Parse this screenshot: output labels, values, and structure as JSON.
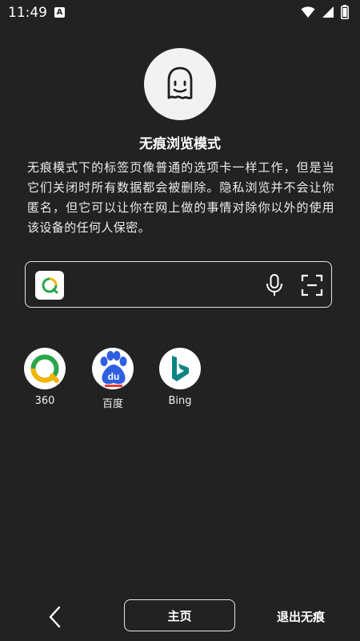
{
  "status_bar": {
    "time": "11:49",
    "notification_icon": "A",
    "icons": [
      "wifi-icon",
      "signal-icon",
      "battery-icon"
    ]
  },
  "incognito": {
    "icon": "ghost-icon",
    "title": "无痕浏览模式",
    "description": "无痕模式下的标签页像普通的选项卡一样工作，但是当它们关闭时所有数据都会被删除。隐私浏览并不会让你匿名，但它可以让你在网上做的事情对除你以外的使用该设备的任何人保密。"
  },
  "search": {
    "engine_icon": "360-search-icon",
    "mic_icon": "microphone-icon",
    "scan_icon": "scan-icon"
  },
  "shortcuts": [
    {
      "label": "360",
      "icon": "360-icon"
    },
    {
      "label": "百度",
      "icon": "baidu-icon"
    },
    {
      "label": "Bing",
      "icon": "bing-icon"
    }
  ],
  "bottom_bar": {
    "back_icon": "back-chevron-icon",
    "home_label": "主页",
    "exit_label": "退出无痕"
  },
  "colors": {
    "background": "#222222",
    "text": "#ffffff",
    "bing_teal": "#0c8484",
    "baidu_blue": "#2f5fe0"
  }
}
